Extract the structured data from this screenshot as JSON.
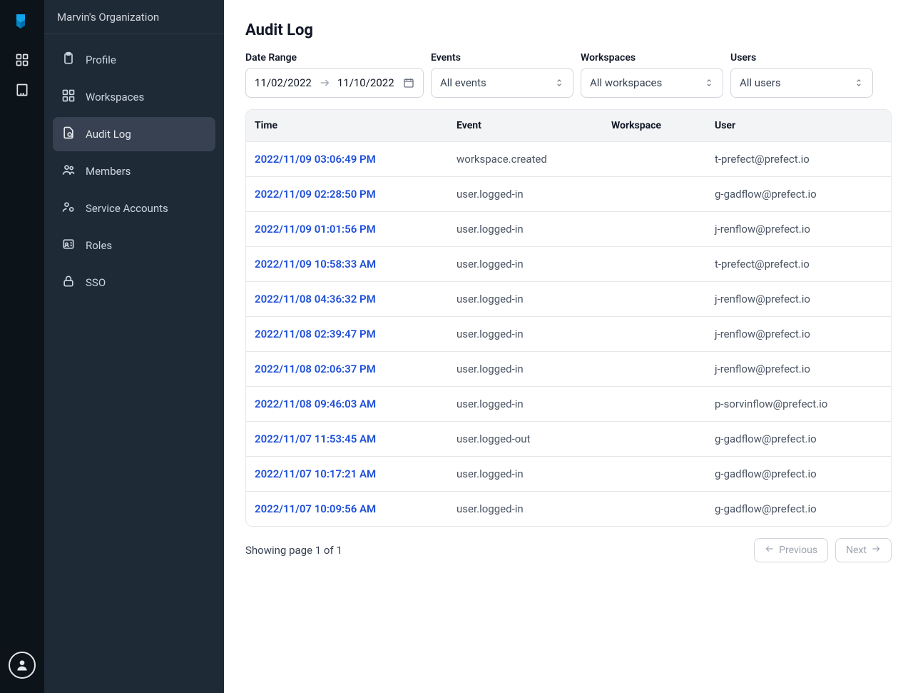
{
  "org_name": "Marvin's Organization",
  "sidebar": {
    "items": [
      {
        "label": "Profile"
      },
      {
        "label": "Workspaces"
      },
      {
        "label": "Audit Log"
      },
      {
        "label": "Members"
      },
      {
        "label": "Service Accounts"
      },
      {
        "label": "Roles"
      },
      {
        "label": "SSO"
      }
    ],
    "active_index": 2
  },
  "page": {
    "title": "Audit Log"
  },
  "filters": {
    "date_range": {
      "label": "Date Range",
      "start": "11/02/2022",
      "end": "11/10/2022"
    },
    "events": {
      "label": "Events",
      "value": "All events"
    },
    "workspaces": {
      "label": "Workspaces",
      "value": "All workspaces"
    },
    "users": {
      "label": "Users",
      "value": "All users"
    }
  },
  "table": {
    "headers": {
      "time": "Time",
      "event": "Event",
      "workspace": "Workspace",
      "user": "User"
    },
    "rows": [
      {
        "time": "2022/11/09 03:06:49 PM",
        "event": "workspace.created",
        "workspace": "",
        "user": "t-prefect@prefect.io"
      },
      {
        "time": "2022/11/09 02:28:50 PM",
        "event": "user.logged-in",
        "workspace": "",
        "user": "g-gadflow@prefect.io"
      },
      {
        "time": "2022/11/09 01:01:56 PM",
        "event": "user.logged-in",
        "workspace": "",
        "user": "j-renflow@prefect.io"
      },
      {
        "time": "2022/11/09 10:58:33 AM",
        "event": "user.logged-in",
        "workspace": "",
        "user": "t-prefect@prefect.io"
      },
      {
        "time": "2022/11/08 04:36:32 PM",
        "event": "user.logged-in",
        "workspace": "",
        "user": "j-renflow@prefect.io"
      },
      {
        "time": "2022/11/08 02:39:47 PM",
        "event": "user.logged-in",
        "workspace": "",
        "user": "j-renflow@prefect.io"
      },
      {
        "time": "2022/11/08 02:06:37 PM",
        "event": "user.logged-in",
        "workspace": "",
        "user": "j-renflow@prefect.io"
      },
      {
        "time": "2022/11/08 09:46:03 AM",
        "event": "user.logged-in",
        "workspace": "",
        "user": "p-sorvinflow@prefect.io"
      },
      {
        "time": "2022/11/07 11:53:45 AM",
        "event": "user.logged-out",
        "workspace": "",
        "user": "g-gadflow@prefect.io"
      },
      {
        "time": "2022/11/07 10:17:21 AM",
        "event": "user.logged-in",
        "workspace": "",
        "user": "g-gadflow@prefect.io"
      },
      {
        "time": "2022/11/07 10:09:56 AM",
        "event": "user.logged-in",
        "workspace": "",
        "user": "g-gadflow@prefect.io"
      }
    ]
  },
  "pagination": {
    "info": "Showing page 1 of 1",
    "previous_label": "Previous",
    "next_label": "Next"
  }
}
